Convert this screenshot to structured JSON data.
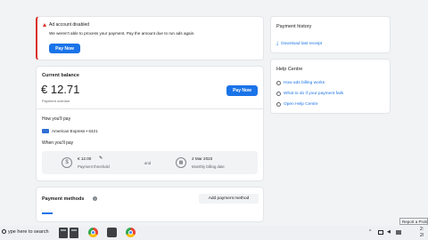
{
  "alert": {
    "title": "Ad account disabled",
    "message": "We weren't able to process your payment. Pay the amount due to run ads again.",
    "button": "Pay Now"
  },
  "balance": {
    "heading": "Current balance",
    "amount": "€ 12.71",
    "status": "Payment overdue",
    "button": "Pay Now",
    "how_heading": "How you'll pay",
    "card_name": "American Express • 6421",
    "when_heading": "When you'll pay",
    "threshold_value": "€ 12.00",
    "threshold_label": "Payment threshold",
    "and_text": "and",
    "billing_date": "2 Mar 2023",
    "billing_label": "Monthly billing date"
  },
  "payment_methods": {
    "heading": "Payment methods",
    "add_button": "Add payment method"
  },
  "history": {
    "heading": "Payment history",
    "download": "Download last receipt"
  },
  "help": {
    "heading": "Help Centre",
    "items": [
      "How ads billing works",
      "What to do if your payment fails",
      "Open Help Centre"
    ]
  },
  "taskbar": {
    "search_placeholder": "ype here to search",
    "clock_time": "2:",
    "clock_date": "2/"
  },
  "tooltip": "Report a Prob",
  "colors": {
    "accent": "#1a73e8",
    "alert": "#d93025"
  }
}
